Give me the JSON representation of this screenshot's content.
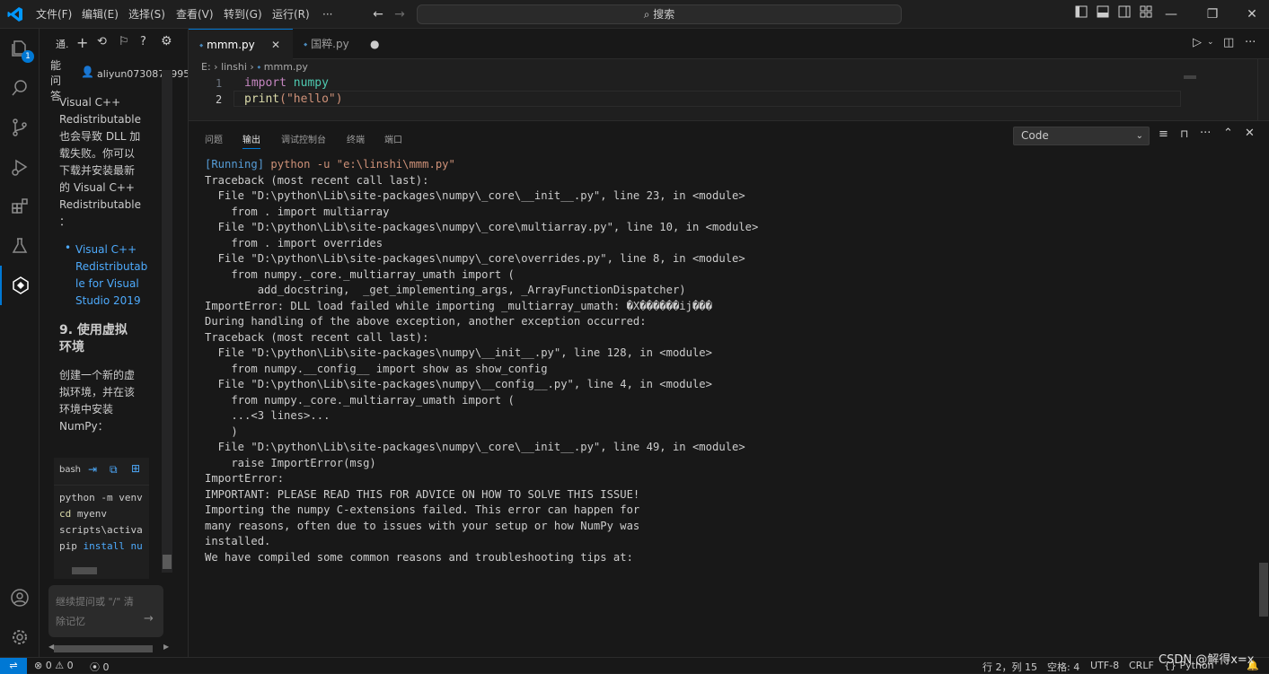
{
  "titlebar": {
    "menus": [
      "文件(F)",
      "编辑(E)",
      "选择(S)",
      "查看(V)",
      "转到(G)",
      "运行(R)",
      "···"
    ],
    "search_label": "搜索"
  },
  "activity": {
    "explorer_badge": "1"
  },
  "side_panel": {
    "header_title": "通.",
    "tab_vertical": [
      "能",
      "问",
      "答"
    ],
    "user": "aliyun0730874995",
    "paragraph1": [
      "Visual C++",
      "Redistributable",
      "也会导致 DLL 加",
      "载失败。你可以",
      "下载并安装最新",
      "的 Visual C++",
      "Redistributable",
      "："
    ],
    "link_lines": [
      "Visual C++",
      "Redistributab",
      "le for Visual",
      "Studio 2019"
    ],
    "heading_lines": [
      "9. 使用虚拟",
      "环境"
    ],
    "paragraph2": [
      "创建一个新的虚",
      "拟环境，并在该",
      "环境中安装",
      "NumPy："
    ],
    "code_lang": "bash",
    "code_lines": [
      {
        "a": "python -m venv",
        "b": ""
      },
      {
        "a": "cd",
        "b": " myenv"
      },
      {
        "a": "scripts\\activa",
        "b": ""
      },
      {
        "a": "pip ",
        "b": "install nu"
      }
    ],
    "input_placeholder_1": "继续提问或 \"/\" 清",
    "input_placeholder_2": "除记忆"
  },
  "tabs": [
    {
      "label": "mmm.py",
      "active": true
    },
    {
      "label": "国粹.py",
      "active": false
    }
  ],
  "editor": {
    "breadcrumb": [
      "E:",
      "linshi",
      "mmm.py"
    ],
    "lines": [
      {
        "num": "1",
        "kw": "import",
        "rest": " numpy"
      },
      {
        "num": "2",
        "fn": "print",
        "str": "(\"hello\")"
      }
    ]
  },
  "panel": {
    "tabs": [
      "问题",
      "输出",
      "调试控制台",
      "终端",
      "端口"
    ],
    "active_tab": "输出",
    "channel": "Code",
    "running_prefix": "[Running]",
    "running_cmd": " python -u \"e:\\linshi\\mmm.py\"",
    "output_lines": [
      "Traceback (most recent call last):",
      "  File \"D:\\python\\Lib\\site-packages\\numpy\\_core\\__init__.py\", line 23, in <module>",
      "    from . import multiarray",
      "  File \"D:\\python\\Lib\\site-packages\\numpy\\_core\\multiarray.py\", line 10, in <module>",
      "    from . import overrides",
      "  File \"D:\\python\\Lib\\site-packages\\numpy\\_core\\overrides.py\", line 8, in <module>",
      "    from numpy._core._multiarray_umath import (",
      "        add_docstring,  _get_implementing_args, _ArrayFunctionDispatcher)",
      "ImportError: DLL load failed while importing _multiarray_umath: �X������ij���",
      "",
      "During handling of the above exception, another exception occurred:",
      "",
      "Traceback (most recent call last):",
      "  File \"D:\\python\\Lib\\site-packages\\numpy\\__init__.py\", line 128, in <module>",
      "    from numpy.__config__ import show as show_config",
      "  File \"D:\\python\\Lib\\site-packages\\numpy\\__config__.py\", line 4, in <module>",
      "    from numpy._core._multiarray_umath import (",
      "    ...<3 lines>...",
      "    )",
      "  File \"D:\\python\\Lib\\site-packages\\numpy\\_core\\__init__.py\", line 49, in <module>",
      "    raise ImportError(msg)",
      "ImportError:",
      "",
      "IMPORTANT: PLEASE READ THIS FOR ADVICE ON HOW TO SOLVE THIS ISSUE!",
      "",
      "Importing the numpy C-extensions failed. This error can happen for",
      "many reasons, often due to issues with your setup or how NumPy was",
      "installed.",
      "",
      "We have compiled some common reasons and troubleshooting tips at:"
    ]
  },
  "statusbar": {
    "errors": "0",
    "warnings": "0",
    "ports": "0",
    "position": "行 2，列 15",
    "spaces": "空格: 4",
    "encoding": "UTF-8",
    "eol": "CRLF",
    "language": "Python",
    "watermark": "CSDN @解得x=x"
  },
  "colors": {
    "accent": "#0078d4",
    "keyword": "#c586c0",
    "module": "#4ec9b0",
    "function": "#dcdcaa",
    "string": "#ce9178",
    "running": "#569cd6",
    "link": "#4daafc"
  }
}
